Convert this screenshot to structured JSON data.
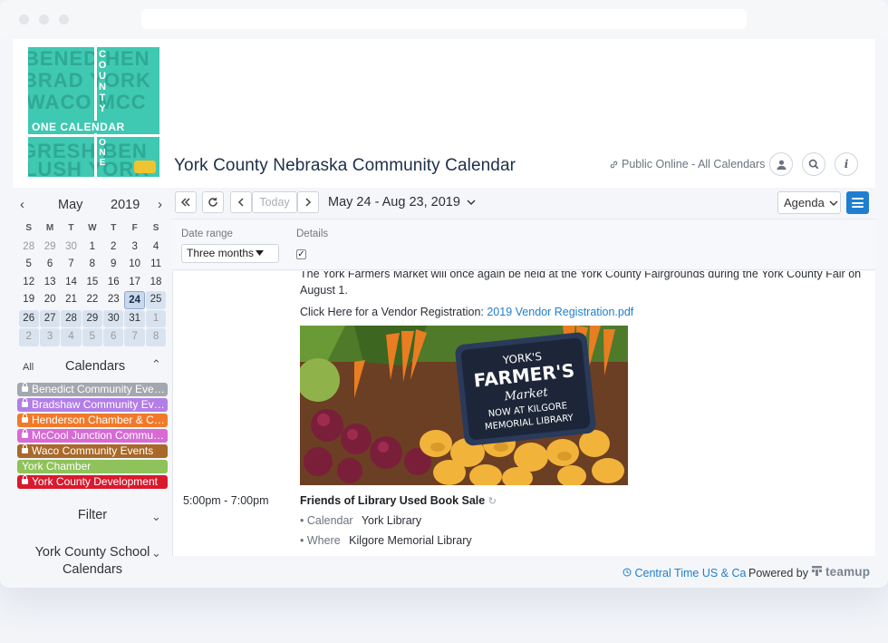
{
  "header": {
    "logo": {
      "line1": "ONE CALENDAR",
      "vertical_top": "COUNTY",
      "vertical_bottom": "ONE"
    },
    "title": "York County Nebraska Community Calendar",
    "public_link": "Public Online - All Calendars",
    "buttons": [
      "user-icon",
      "search-icon",
      "info-icon"
    ]
  },
  "mini_calendar": {
    "month": "May",
    "year": "2019",
    "weekdays": [
      "S",
      "M",
      "T",
      "W",
      "T",
      "F",
      "S"
    ],
    "weeks": [
      [
        "28",
        "29",
        "30",
        "1",
        "2",
        "3",
        "4"
      ],
      [
        "5",
        "6",
        "7",
        "8",
        "9",
        "10",
        "11"
      ],
      [
        "12",
        "13",
        "14",
        "15",
        "16",
        "17",
        "18"
      ],
      [
        "19",
        "20",
        "21",
        "22",
        "23",
        "24",
        "25"
      ],
      [
        "26",
        "27",
        "28",
        "29",
        "30",
        "31",
        "1"
      ],
      [
        "2",
        "3",
        "4",
        "5",
        "6",
        "7",
        "8"
      ]
    ],
    "today": "24"
  },
  "calendars": {
    "all_label": "All",
    "label": "Calendars",
    "items": [
      {
        "name": "Benedict Community Events",
        "color": "#a3a8ae"
      },
      {
        "name": "Bradshaw Community Events",
        "color": "#b37ee6"
      },
      {
        "name": "Henderson Chamber & Community",
        "color": "#f07a2a"
      },
      {
        "name": "McCool Junction Community",
        "color": "#d76ad5"
      },
      {
        "name": "Waco Community Events",
        "color": "#a8692a"
      },
      {
        "name": "York Chamber",
        "color": "#8fc25a"
      },
      {
        "name": "York County Development",
        "color": "#d9192e"
      }
    ]
  },
  "filter": {
    "label": "Filter"
  },
  "school": {
    "label": "York County School Calendars"
  },
  "toolbar": {
    "today_label": "Today",
    "range": "May 24 - Aug 23, 2019",
    "view_label": "Agenda"
  },
  "options": {
    "date_range_label": "Date range",
    "date_range_value": "Three months",
    "details_label": "Details",
    "details_checked": "✓"
  },
  "event_detail": {
    "description": "The York Farmers Market will once again be held at the York County Fairgrounds during the York County Fair on August 1.",
    "registration_prefix": "Click Here for a Vendor Registration:",
    "registration_link": "2019 Vendor Registration.pdf",
    "sign": {
      "line1": "YORK'S",
      "line2": "FARMER'S",
      "line3": "Market",
      "line4": "NOW AT KILGORE",
      "line5": "MEMORIAL LIBRARY"
    }
  },
  "next_event": {
    "time": "5:00pm - 7:00pm",
    "title": "Friends of Library Used Book Sale",
    "calendar_key": "Calendar",
    "calendar_value": "York Library",
    "where_key": "Where",
    "where_value": "Kilgore Memorial Library"
  },
  "footer": {
    "timezone": "Central Time US & Ca",
    "powered_by": "Powered by",
    "brand": "teamup"
  }
}
